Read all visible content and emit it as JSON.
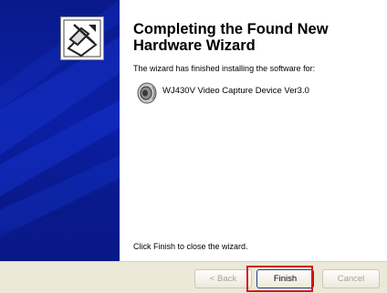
{
  "wizard": {
    "title": "Completing the Found New Hardware Wizard",
    "subtitle": "The wizard has finished installing the software for:",
    "device_name": "WJ430V Video Capture Device Ver3.0",
    "close_instruction": "Click Finish to close the wizard."
  },
  "buttons": {
    "back_label": "< Back",
    "finish_label": "Finish",
    "cancel_label": "Cancel"
  },
  "icons": {
    "banner_icon": "hardware-wizard-icon",
    "device_icon": "speaker-icon"
  },
  "colors": {
    "banner_blue": "#0b1fa6",
    "button_bar": "#ece9d8",
    "highlight_red": "#d21a1a"
  }
}
